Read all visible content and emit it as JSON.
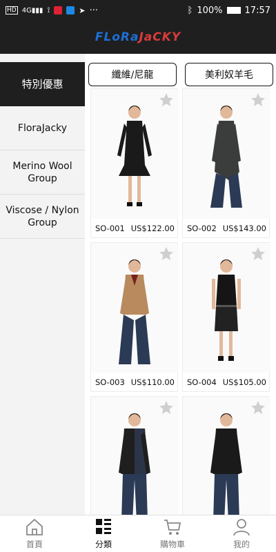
{
  "status": {
    "left_icons": [
      "hd-icon",
      "signal-4g-icon",
      "usb-icon",
      "notification-icon",
      "app-icon",
      "telegram-icon"
    ],
    "battery": "100%",
    "time": "17:57"
  },
  "header": {
    "logo_part1": "FLoRa",
    "logo_part2": "JaCKY"
  },
  "sidebar": {
    "items": [
      {
        "label": "特別優惠",
        "active": true
      },
      {
        "label": "FloraJacky",
        "active": false
      },
      {
        "label": "Merino Wool Group",
        "active": false
      },
      {
        "label": "Viscose / Nylon Group",
        "active": false
      }
    ]
  },
  "tabs": [
    {
      "label": "纖維/尼龍"
    },
    {
      "label": "美利奴羊毛"
    }
  ],
  "products": [
    {
      "code": "SO-001",
      "price": "US$122.00",
      "style": "dress",
      "color": "#1a1a1a"
    },
    {
      "code": "SO-002",
      "price": "US$143.00",
      "style": "tunic",
      "color": "#3a3d3b"
    },
    {
      "code": "SO-003",
      "price": "US$110.00",
      "style": "sweater",
      "color": "#b88a5e"
    },
    {
      "code": "SO-004",
      "price": "US$105.00",
      "style": "shift",
      "color": "#151515"
    },
    {
      "code": "",
      "price": "",
      "style": "man",
      "color": "#1f1f1f"
    },
    {
      "code": "",
      "price": "",
      "style": "man2",
      "color": "#1a1a1a"
    }
  ],
  "tabbar": [
    {
      "label": "首頁",
      "icon": "home-icon",
      "active": false
    },
    {
      "label": "分類",
      "icon": "category-icon",
      "active": true
    },
    {
      "label": "購物車",
      "icon": "cart-icon",
      "active": false
    },
    {
      "label": "我的",
      "icon": "user-icon",
      "active": false
    }
  ]
}
